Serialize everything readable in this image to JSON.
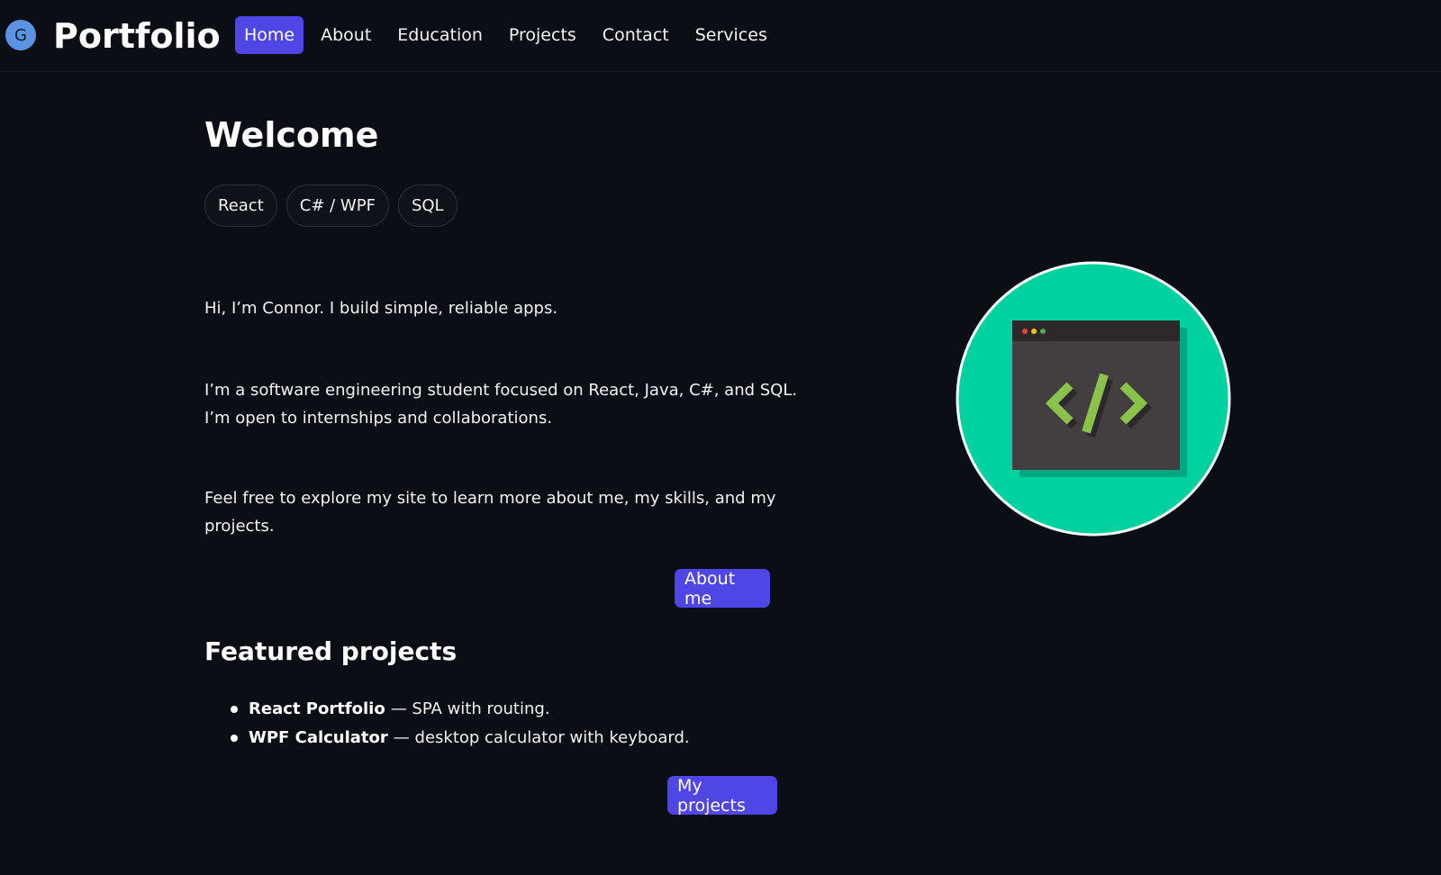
{
  "header": {
    "avatar_letter": "G",
    "brand": "Portfolio",
    "nav": [
      {
        "label": "Home",
        "active": true
      },
      {
        "label": "About"
      },
      {
        "label": "Education"
      },
      {
        "label": "Projects"
      },
      {
        "label": "Contact"
      },
      {
        "label": "Services"
      }
    ]
  },
  "hero": {
    "title": "Welcome",
    "chips": [
      "React",
      "C# / WPF",
      "SQL"
    ],
    "intro": "Hi, I’m Connor. I build simple, reliable apps.",
    "bio": "I’m a software engineering student focused on React, Java, C#, and SQL. I’m open to internships and collaborations.",
    "explore": "Feel free to explore my site to learn more about me, my skills, and my projects.",
    "about_button": "About me",
    "illustration_icon": "code-window-icon"
  },
  "featured": {
    "title": "Featured projects",
    "items": [
      {
        "name": "React Portfolio",
        "desc": "— SPA with routing."
      },
      {
        "name": "WPF Calculator",
        "desc": "— desktop calculator with keyboard."
      }
    ],
    "button": "My projects"
  },
  "colors": {
    "background": "#0b0e15",
    "accent": "#4f46e5",
    "illustration_bg": "#00d1a0",
    "code_green": "#8bc34a"
  }
}
